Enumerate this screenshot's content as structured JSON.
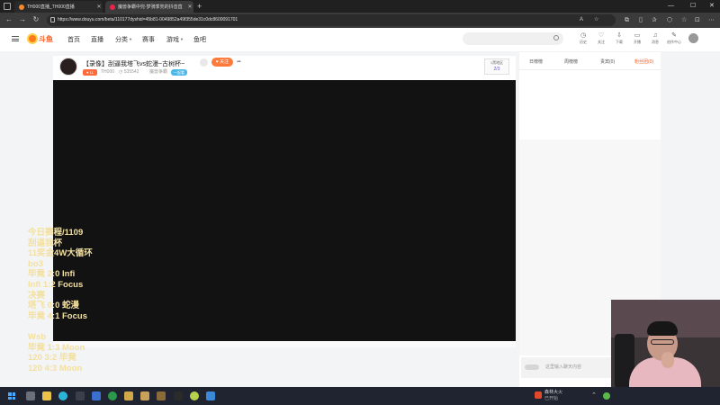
{
  "browser": {
    "tabs": [
      {
        "label": "TH000直播_TH000直播",
        "active": false
      },
      {
        "label": "魔兽争霸中兜-梦骑季兜的抖音直",
        "active": true
      }
    ],
    "url": "https://www.douyu.com/beta/110177dyshid=45b81-0049852a49f355de31c0dc8600091701"
  },
  "site": {
    "brand": "斗鱼",
    "nav": [
      "首页",
      "直播",
      "分类",
      "赛事",
      "游戏",
      "鱼吧"
    ],
    "header_icons": [
      {
        "name": "history-icon",
        "glyph": "◷",
        "label": "历史"
      },
      {
        "name": "follow-icon",
        "glyph": "♡",
        "label": "关注"
      },
      {
        "name": "download-icon",
        "glyph": "⇩",
        "label": "下载"
      },
      {
        "name": "broadcast-icon",
        "glyph": "▭",
        "label": "开播"
      },
      {
        "name": "message-icon",
        "glyph": "♫",
        "label": "消息"
      },
      {
        "name": "creator-icon",
        "glyph": "✎",
        "label": "创作中心"
      }
    ]
  },
  "room": {
    "title": "【录像】刮逼我塔飞vs蛇漫~古树杯~",
    "follow_label": "♥ 关注",
    "level": "♥ 11",
    "streamer": "TH000",
    "viewers": "◷ 535542",
    "category": "魔兽争霸",
    "category_tag": "一起看",
    "mini_top": "1黑地区",
    "mini_bottom": "2/3"
  },
  "sidebar": {
    "tabs": [
      "日榜榜",
      "周榜榜",
      "贵宾(0)",
      "粉丝团(0)"
    ],
    "chat_placeholder": "这里输入聊天内容"
  },
  "overlay": {
    "lines": [
      "今日赛程/1109",
      "刮逼我杯",
      "11奖金4W大循环",
      "bo3",
      "毕竟 2:0 Infi",
      "Infi  1:2 Focus",
      "决赛",
      "塔飞 0:0 蛇漫",
      "毕竟 4:1 Focus",
      "",
      "Wsb",
      "毕竟 1:3 Moon",
      "120 3:2 毕竟",
      "120 4:3 Moon"
    ]
  },
  "taskbar": {
    "weather_temp": "森林大火",
    "weather_sub": "已开始"
  },
  "colors": {
    "accent": "#ff5a1a",
    "overlay_text": "#f3e0a0",
    "player_bg": "#121212"
  }
}
